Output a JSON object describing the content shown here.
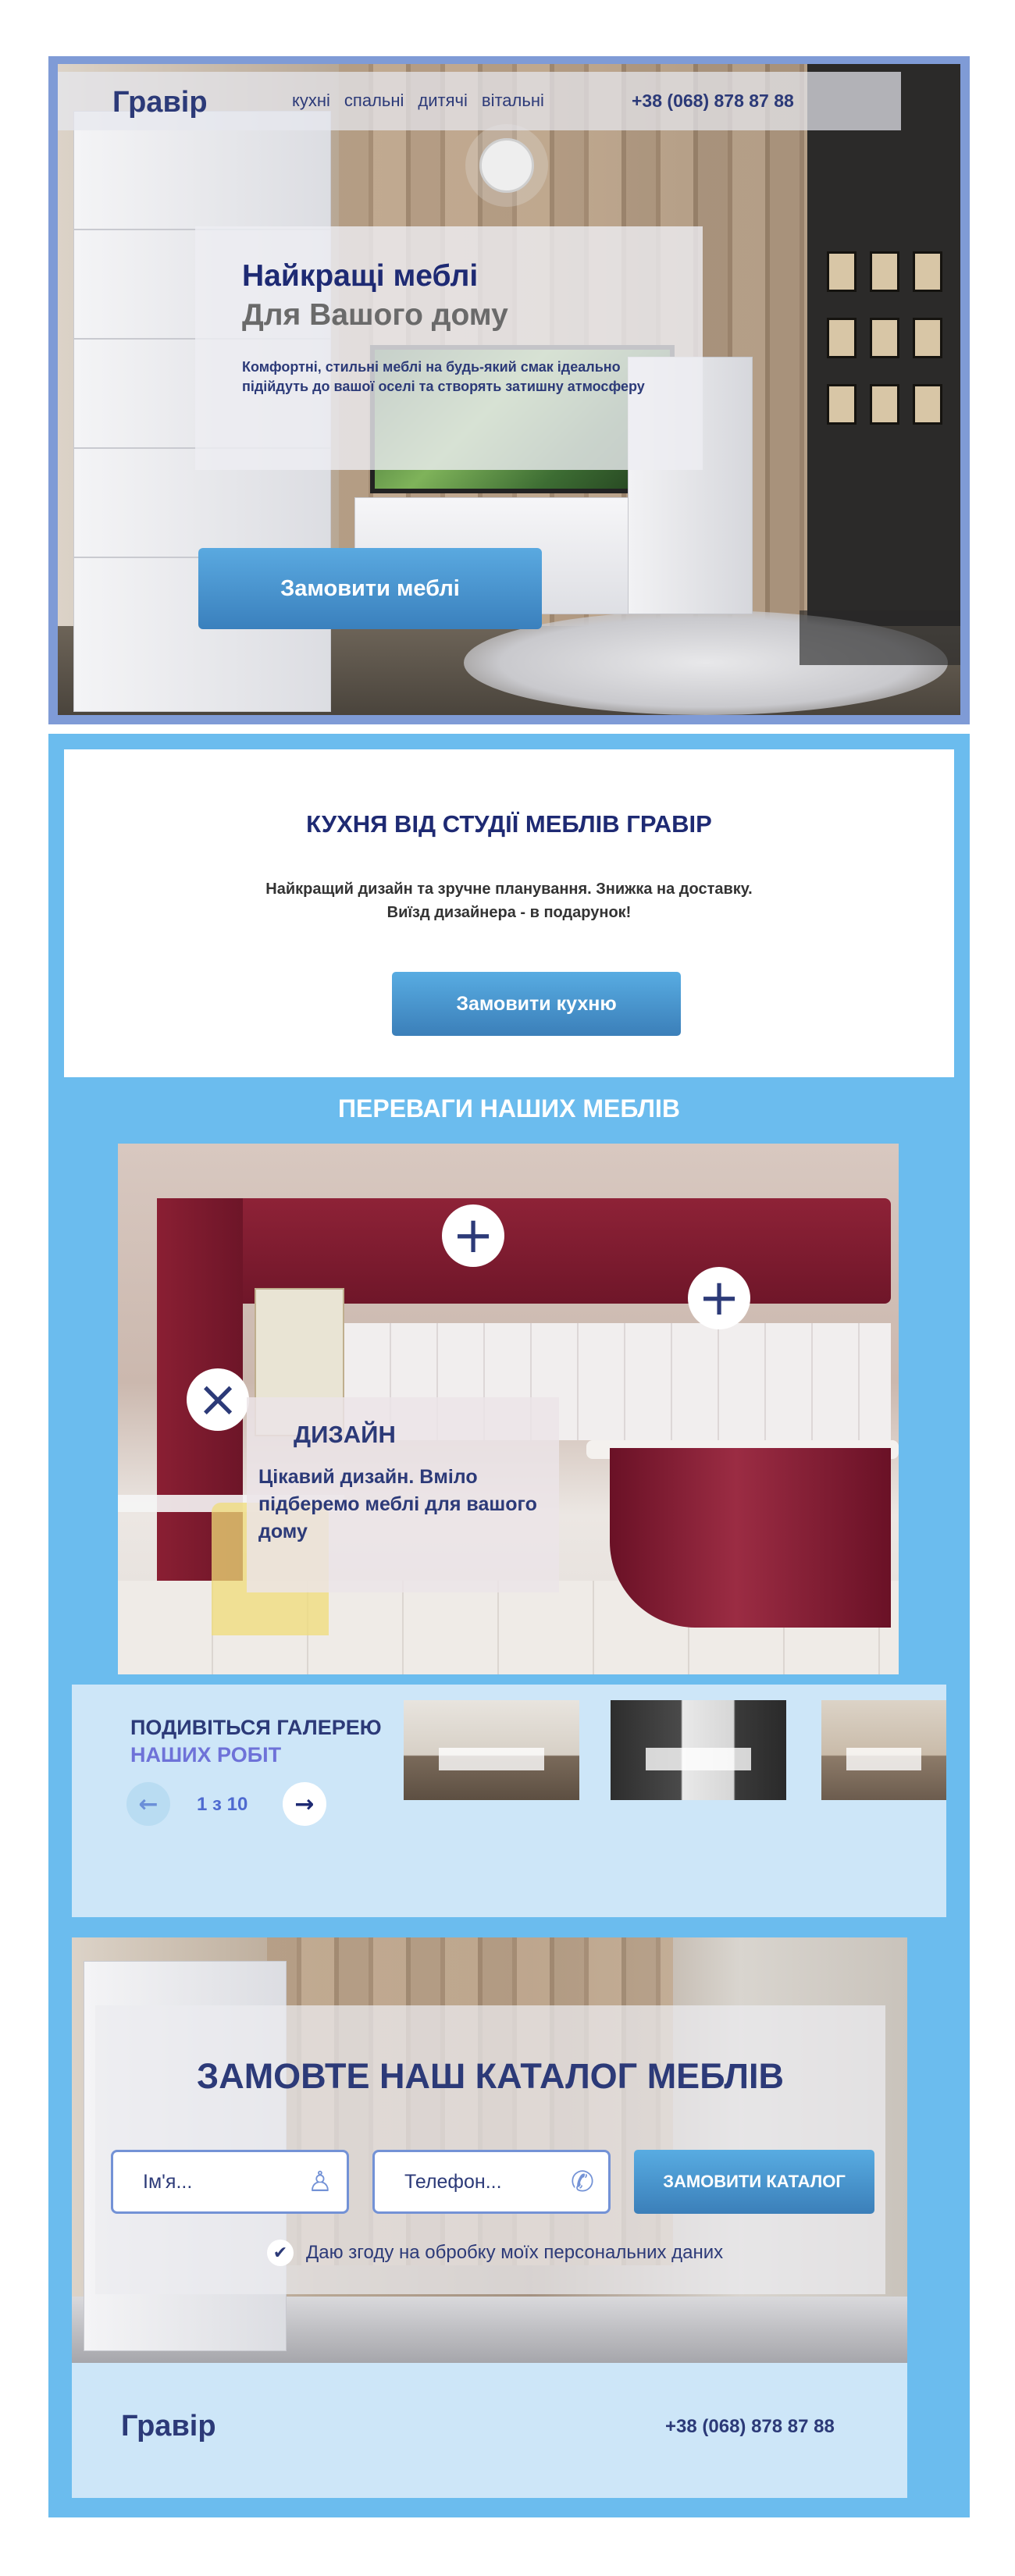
{
  "header": {
    "logo": "Гравір",
    "menu": [
      "кухні",
      "спальні",
      "дитячі",
      "вітальні"
    ],
    "phone": "+38 (068) 878 87 88"
  },
  "hero": {
    "title": "Найкращі меблі",
    "subtitle": "Для Вашого дому",
    "text": "Комфортні, стильні меблі на будь-який смак ідеально підійдуть до вашої оселі та створять затишну атмосферу",
    "button": "Замовити меблі"
  },
  "kitchen": {
    "title": "КУХНЯ ВІД СТУДІЇ МЕБЛІВ ГРАВІР",
    "line1": "Найкращий дизайн та зручне планування.  Знижка на доставку.",
    "line2": "Виїзд дизайнера - в подарунок!",
    "button": "Замовити кухню"
  },
  "advantages": {
    "title": "ПЕРЕВАГИ НАШИХ МЕБЛІВ",
    "hotspot_open_icon": "plus-icon",
    "hotspot_close_icon": "close-icon",
    "info_title": "ДИЗАЙН",
    "info_text": "Цікавий дизайн. Вміло підберемо меблі для вашого дому"
  },
  "gallery": {
    "title_line1": "ПОДИВІТЬСЯ ГАЛЕРЕЮ",
    "title_line2": "НАШИХ РОБІТ",
    "pager": "1 з 10",
    "prev_icon": "arrow-left-icon",
    "next_icon": "arrow-right-icon",
    "thumb_count": 3
  },
  "catalog": {
    "title": "ЗАМОВТЕ НАШ КАТАЛОГ МЕБЛІВ",
    "name_placeholder": "Ім'я...",
    "phone_placeholder": "Телефон...",
    "name_icon": "user-icon",
    "phone_icon": "phone-icon",
    "button": "ЗАМОВИТИ КАТАЛОГ",
    "consent": "Даю згоду на обробку моїх персональних даних",
    "consent_checked": true
  },
  "footer": {
    "logo": "Гравір",
    "phone": "+38 (068) 878 87 88"
  },
  "colors": {
    "primary": "#2c3a78",
    "accent": "#3b7fb9",
    "section_bg": "#6bbcee",
    "light_panel": "#cde6f8",
    "hero_frame": "#7f9bd6"
  }
}
